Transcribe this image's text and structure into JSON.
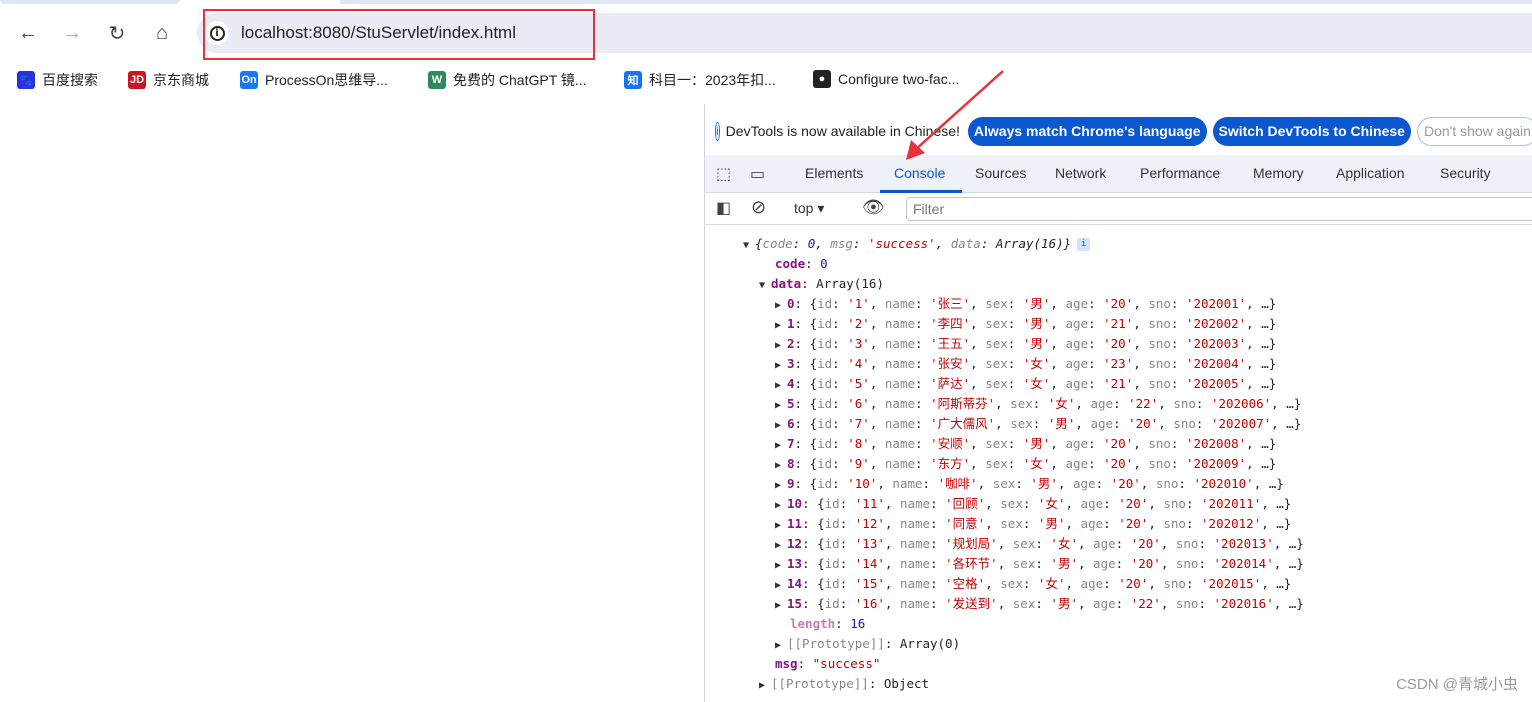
{
  "browser": {
    "url": "localhost:8080/StuServlet/index.html",
    "bookmarks": [
      {
        "label": "百度搜索",
        "icon": "baidu-icon",
        "color": "#2932e1",
        "glyph": "🐾"
      },
      {
        "label": "京东商城",
        "icon": "jd-icon",
        "color": "#c91623",
        "glyph": "JD"
      },
      {
        "label": "ProcessOn思维导...",
        "icon": "processon-icon",
        "color": "#1677ff",
        "glyph": "On"
      },
      {
        "label": "免费的 ChatGPT 镜...",
        "icon": "chatgpt-mirror-icon",
        "color": "#2e8b57",
        "glyph": "W"
      },
      {
        "label": "科目一：2023年扣...",
        "icon": "zhihu-icon",
        "color": "#1772f6",
        "glyph": "知"
      },
      {
        "label": "Configure two-fac...",
        "icon": "github-icon",
        "color": "#222222",
        "glyph": "●"
      }
    ]
  },
  "devtools": {
    "infobar": {
      "message": "DevTools is now available in Chinese!",
      "btn_match": "Always match Chrome's language",
      "btn_switch": "Switch DevTools to Chinese",
      "btn_dont": "Don't show again"
    },
    "tabs": [
      "Elements",
      "Console",
      "Sources",
      "Network",
      "Performance",
      "Memory",
      "Application",
      "Security"
    ],
    "active_tab": "Console",
    "context": "top",
    "filter_placeholder": "Filter",
    "console": {
      "summary": {
        "code": "0",
        "msg": "'success'",
        "data": "Array(16)"
      },
      "code": "0",
      "data_label": "Array(16)",
      "rows": [
        {
          "id": "1",
          "name": "张三",
          "sex": "男",
          "age": "20",
          "sno": "202001"
        },
        {
          "id": "2",
          "name": "李四",
          "sex": "男",
          "age": "21",
          "sno": "202002"
        },
        {
          "id": "3",
          "name": "王五",
          "sex": "男",
          "age": "20",
          "sno": "202003"
        },
        {
          "id": "4",
          "name": "张安",
          "sex": "女",
          "age": "23",
          "sno": "202004"
        },
        {
          "id": "5",
          "name": "萨达",
          "sex": "女",
          "age": "21",
          "sno": "202005"
        },
        {
          "id": "6",
          "name": "阿斯蒂芬",
          "sex": "女",
          "age": "22",
          "sno": "202006"
        },
        {
          "id": "7",
          "name": "广大儒风",
          "sex": "男",
          "age": "20",
          "sno": "202007"
        },
        {
          "id": "8",
          "name": "安顺",
          "sex": "男",
          "age": "20",
          "sno": "202008"
        },
        {
          "id": "9",
          "name": "东方",
          "sex": "女",
          "age": "20",
          "sno": "202009"
        },
        {
          "id": "10",
          "name": "咖啡",
          "sex": "男",
          "age": "20",
          "sno": "202010"
        },
        {
          "id": "11",
          "name": "回顾",
          "sex": "女",
          "age": "20",
          "sno": "202011"
        },
        {
          "id": "12",
          "name": "同意",
          "sex": "男",
          "age": "20",
          "sno": "202012"
        },
        {
          "id": "13",
          "name": "规划局",
          "sex": "女",
          "age": "20",
          "sno": "202013"
        },
        {
          "id": "14",
          "name": "各环节",
          "sex": "男",
          "age": "20",
          "sno": "202014"
        },
        {
          "id": "15",
          "name": "空格",
          "sex": "女",
          "age": "20",
          "sno": "202015"
        },
        {
          "id": "16",
          "name": "发送到",
          "sex": "男",
          "age": "22",
          "sno": "202016"
        }
      ],
      "length": "16",
      "array_proto": "Array(0)",
      "msg": "\"success\"",
      "obj_proto": "Object"
    }
  },
  "watermark": "CSDN @青城小虫",
  "colors": {
    "annotation_red": "#e8323a",
    "accent": "#0b57d0"
  }
}
